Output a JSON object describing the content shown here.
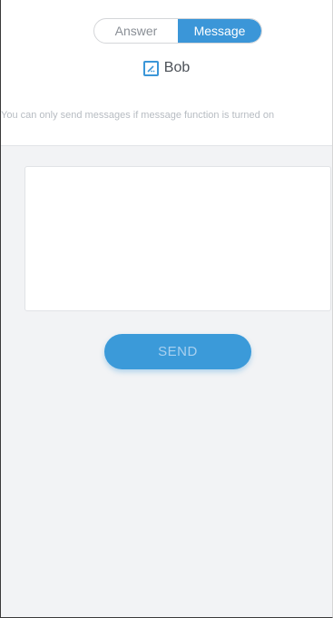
{
  "tabs": {
    "answer_label": "Answer",
    "message_label": "Message",
    "active": "Message"
  },
  "contact": {
    "name": "Bob",
    "icon": "edit-icon"
  },
  "notice": "You can only send messages if message function is turned on",
  "message": {
    "value": "",
    "placeholder": ""
  },
  "send_label": "SEND",
  "colors": {
    "accent": "#3b96d8",
    "background": "#f2f3f5"
  }
}
